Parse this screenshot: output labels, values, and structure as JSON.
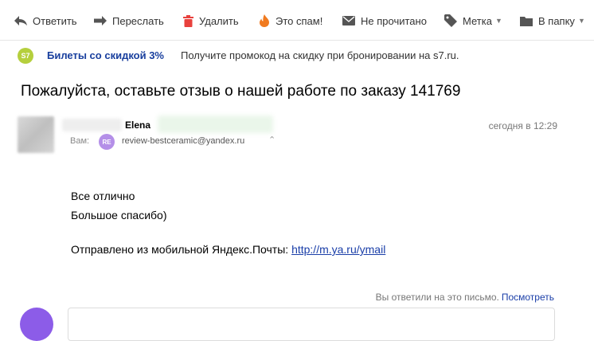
{
  "toolbar": {
    "reply": "Ответить",
    "forward": "Переслать",
    "delete": "Удалить",
    "spam": "Это спам!",
    "unread": "Не прочитано",
    "label": "Метка",
    "folder": "В папку"
  },
  "promo": {
    "logo_text": "S7",
    "title": "Билеты со скидкой 3%",
    "text": "Получите промокод на скидку при бронировании на s7.ru."
  },
  "message": {
    "subject": "Пожалуйста, оставьте отзыв о нашей работе по заказу 141769",
    "sender_name": "Elena",
    "date": "сегодня в 12:29",
    "to_label": "Вам:",
    "to_badge": "RE",
    "to_email": "review-bestceramic@yandex.ru",
    "body_line1": "Все отлично",
    "body_line2": "Большое спасибо)",
    "signature_text": "Отправлено из мобильной Яндекс.Почты:",
    "signature_link": "http://m.ya.ru/ymail"
  },
  "reply": {
    "note": "Вы ответили на это письмо.",
    "view_link": "Посмотреть"
  },
  "colors": {
    "accent_blue": "#1a3ea8",
    "promo_title": "#193f9e",
    "delete_red": "#e8413d",
    "spam_orange": "#f07a1f",
    "s7_green": "#b5cf3d",
    "avatar_purple": "#8c5ce8"
  }
}
